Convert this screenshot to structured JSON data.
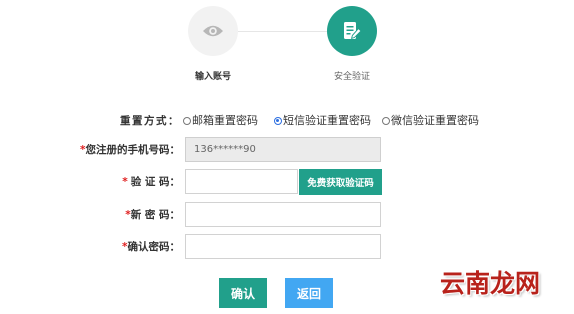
{
  "steps": [
    {
      "label": "输入账号",
      "icon": "eye-icon",
      "active": false
    },
    {
      "label": "安全验证",
      "icon": "edit-document-icon",
      "active": true
    }
  ],
  "form": {
    "required_mark": "*",
    "reset_method": {
      "label": "重置方式：",
      "options": [
        {
          "label": "邮箱重置密码",
          "selected": false
        },
        {
          "label": "短信验证重置密码",
          "selected": true
        },
        {
          "label": "微信验证重置密码",
          "selected": false
        }
      ]
    },
    "phone": {
      "label": "您注册的手机号码：",
      "value": "136******90"
    },
    "code": {
      "label": "验 证 码：",
      "value": "",
      "button": "免费获取验证码"
    },
    "new_password": {
      "label": "新 密 码：",
      "value": ""
    },
    "confirm_password": {
      "label": "确认密码：",
      "value": ""
    }
  },
  "actions": {
    "confirm": "确认",
    "back": "返回"
  },
  "watermark": "云南龙网",
  "colors": {
    "teal": "#21a08b",
    "blue": "#42a7f2",
    "required": "#e02020",
    "watermark": "#b8221b"
  }
}
